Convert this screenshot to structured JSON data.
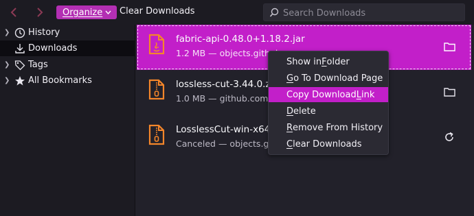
{
  "toolbar": {
    "back_icon": "chevron-left-icon",
    "forward_icon": "chevron-right-icon",
    "organize_label": "Organize",
    "clear_downloads_label": "Clear Downloads",
    "search_placeholder": "Search Downloads"
  },
  "sidebar": {
    "items": [
      {
        "label": "History",
        "icon": "clock-icon",
        "expandable": true
      },
      {
        "label": "Downloads",
        "icon": "download-icon",
        "expandable": false,
        "selected": true
      },
      {
        "label": "Tags",
        "icon": "tag-icon",
        "expandable": true
      },
      {
        "label": "All Bookmarks",
        "icon": "star-icon",
        "expandable": true
      }
    ]
  },
  "downloads": [
    {
      "name": "fabric-api-0.48.0+1.18.2.jar",
      "meta": "1.2 MB — objects.githubu",
      "action_icon": "folder-icon",
      "selected": true
    },
    {
      "name": "lossless-cut-3.44.0.zip",
      "meta": "1.0 MB — github.com — 2",
      "action_icon": "folder-icon"
    },
    {
      "name": "LosslessCut-win-x64.zip",
      "meta": "Canceled — objects.githu",
      "action_icon": "retry-icon"
    }
  ],
  "context_menu": {
    "items": [
      {
        "pre": "Show in ",
        "key": "F",
        "post": "older"
      },
      {
        "pre": "",
        "key": "G",
        "post": "o To Download Page"
      },
      {
        "pre": "Copy Download ",
        "key": "L",
        "post": "ink",
        "active": true
      },
      {
        "pre": "",
        "key": "D",
        "post": "elete"
      },
      {
        "pre": "",
        "key": "R",
        "post": "emove From History"
      },
      {
        "pre": "",
        "key": "C",
        "post": "lear Downloads"
      }
    ]
  },
  "colors": {
    "accent": "#c21fc9",
    "file_icon": "#f5862a",
    "background": "#1c1b22"
  }
}
